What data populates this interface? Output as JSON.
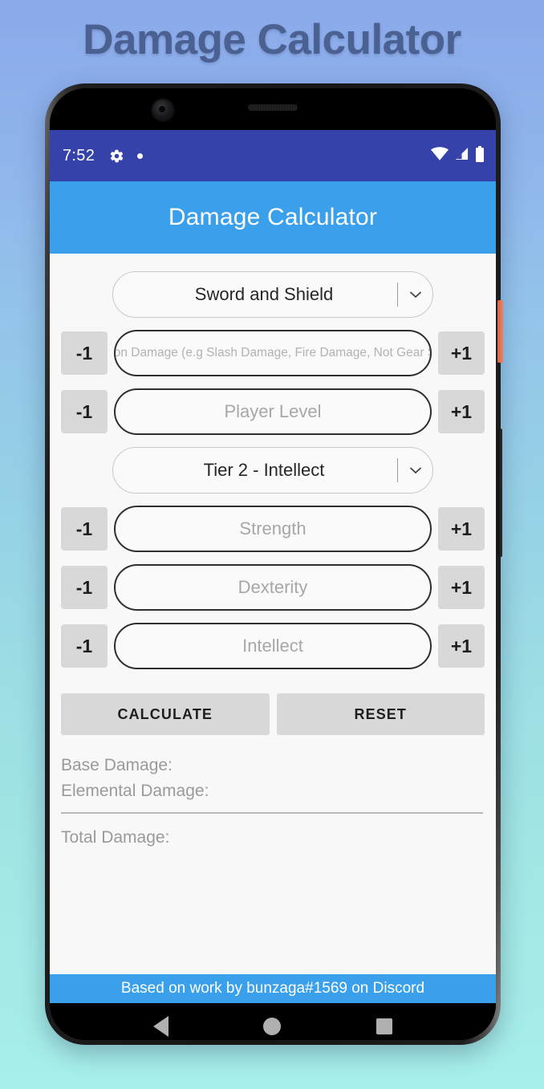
{
  "page": {
    "title": "Damage Calculator"
  },
  "device": {
    "icons": {
      "camera": "camera-lens",
      "speaker": "earpiece-speaker",
      "power": "power-button",
      "volume": "volume-rocker"
    }
  },
  "statusbar": {
    "time": "7:52",
    "gear_icon": "gear-icon",
    "dot_icon": "dot-indicator-icon",
    "wifi_icon": "wifi-icon",
    "signal_icon": "cellular-signal-icon",
    "battery_icon": "battery-icon",
    "background": "#3442a9"
  },
  "appbar": {
    "title": "Damage Calculator",
    "background": "#3aa0ec"
  },
  "form": {
    "weapon_select": {
      "value": "Sword and Shield",
      "arrow_icon": "chevron-down-icon"
    },
    "tier_select": {
      "value": "Tier 2 - Intellect",
      "arrow_icon": "chevron-down-icon"
    },
    "decrement_label": "-1",
    "increment_label": "+1",
    "fields": [
      {
        "name": "weapon-damage",
        "value": "",
        "placeholder": "Weapon Damage (e.g Slash Damage, Fire Damage, Not Gear Score)"
      },
      {
        "name": "player-level",
        "value": "",
        "placeholder": "Player Level"
      },
      {
        "name": "strength",
        "value": "",
        "placeholder": "Strength"
      },
      {
        "name": "dexterity",
        "value": "",
        "placeholder": "Dexterity"
      },
      {
        "name": "intellect",
        "value": "",
        "placeholder": "Intellect"
      }
    ]
  },
  "actions": {
    "calculate_label": "CALCULATE",
    "reset_label": "RESET"
  },
  "results": {
    "base_damage": "Base Damage:",
    "elemental_damage": "Elemental Damage:",
    "total_damage": "Total Damage:"
  },
  "footer": {
    "text": "Based on work by bunzaga#1569 on Discord",
    "background": "#3aa0ec"
  },
  "navbar": {
    "back_icon": "back-triangle-icon",
    "home_icon": "home-circle-icon",
    "recents_icon": "recents-square-icon"
  }
}
